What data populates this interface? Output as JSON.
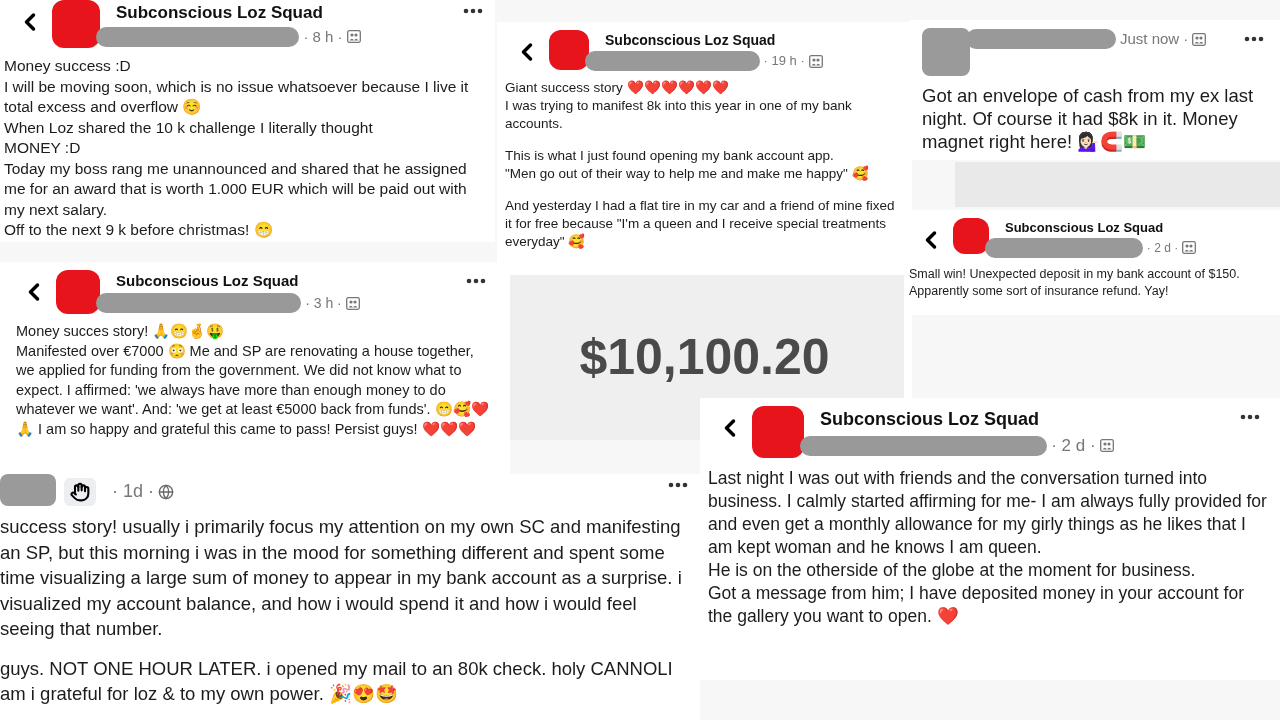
{
  "posts": [
    {
      "avatar": {
        "kind": "group"
      },
      "group": "Subconscious Loz Squad",
      "redacted": true,
      "time": "· 8 h ·",
      "audience": {
        "kind": "group"
      },
      "more": true,
      "back": true,
      "paragraphs": [
        "Money success :D\nI will be moving soon, which is no issue whatsoever because I live it total excess and overflow ☺️\nWhen Loz shared the 10 k challenge I literally thought\nMONEY :D\nToday my boss rang me unannounced and shared that he assigned me for an award that is worth 1.000 EUR which will be paid out with my next salary.\nOff to the next 9 k before christmas! 😁"
      ]
    },
    {
      "avatar": {
        "kind": "group"
      },
      "group": "Subconscious Loz Squad",
      "redacted": true,
      "time": "· 19 h ·",
      "audience": {
        "kind": "group"
      },
      "more": false,
      "back": true,
      "paragraphs": [
        "Giant success story ❤️❤️❤️❤️❤️❤️\nI was trying to manifest 8k into this year in one of my bank accounts.",
        "This is what I just found opening my bank account app.\n\"Men go out of their way to help me and make me happy\" 🥰",
        "And yesterday I had a flat tire in my car and a friend of mine fixed it for free because \"I'm a queen and I receive special treatments everyday\" 🥰"
      ],
      "image": {
        "amount": "$10,100.20"
      }
    },
    {
      "avatar": {
        "kind": "person"
      },
      "redacted": true,
      "time": "Just now ·",
      "audience": {
        "kind": "group"
      },
      "more": true,
      "back": false,
      "paragraphs": [
        "Got an envelope of cash from my ex last night. Of course it had $8k in it. Money magnet right here! 💁🏻‍♀️🧲💵"
      ]
    },
    {
      "avatar": {
        "kind": "group"
      },
      "group": "Subconscious Loz Squad",
      "redacted": true,
      "time": "· 2 d ·",
      "audience": {
        "kind": "group"
      },
      "more": false,
      "back": true,
      "paragraphs": [
        "Small win! Unexpected deposit in my bank account of $150.\nApparently some sort of insurance refund. Yay!"
      ]
    },
    {
      "avatar": {
        "kind": "group"
      },
      "group": "Subconscious Loz Squad",
      "redacted": true,
      "time": "· 3 h ·",
      "audience": {
        "kind": "group"
      },
      "more": true,
      "back": true,
      "paragraphs": [
        "Money succes story! 🙏😁🤞🤑\nManifested over €7000 😳 Me and SP are renovating a house together, we applied for funding from the government. We did not know what to expect. I affirmed: 'we always have more than enough money to do whatever we want'. And: 'we get at least €5000 back from funds'. 😁🥰❤️🙏 I am so happy and grateful this came to pass! Persist guys! ❤️❤️❤️"
      ]
    },
    {
      "avatar": {
        "kind": "group"
      },
      "group": "Subconscious Loz Squad",
      "redacted": true,
      "time": "· 2 d ·",
      "audience": {
        "kind": "group"
      },
      "more": true,
      "back": true,
      "paragraphs": [
        "Last night I was out with friends and the conversation turned into business. I calmly started affirming for me- I am always fully provided for and even get a monthly allowance for my girly things as he likes that I am kept woman and he knows I am queen.\nHe is on the otherside of the globe at the moment for business.\nGot a message from him; I have deposited money in your account for the gallery you want to open. ❤️"
      ]
    },
    {
      "avatar": {
        "kind": "person"
      },
      "badge": {
        "kind": "wave"
      },
      "redacted": false,
      "time": "· 1d ·",
      "audience": {
        "kind": "public"
      },
      "more": true,
      "back": false,
      "paragraphs": [
        "success story! usually i primarily focus my attention on my own SC and manifesting an SP, but this morning i was in the mood for something different and spent some time visualizing a large sum of money to appear in my bank account as a surprise. i visualized my account balance, and how i would spend it and how i would feel seeing that number.",
        "guys. NOT ONE HOUR LATER. i opened my mail to an 80k check. holy CANNOLI am i grateful for loz & to my own power. 🎉😍🤩"
      ]
    }
  ]
}
